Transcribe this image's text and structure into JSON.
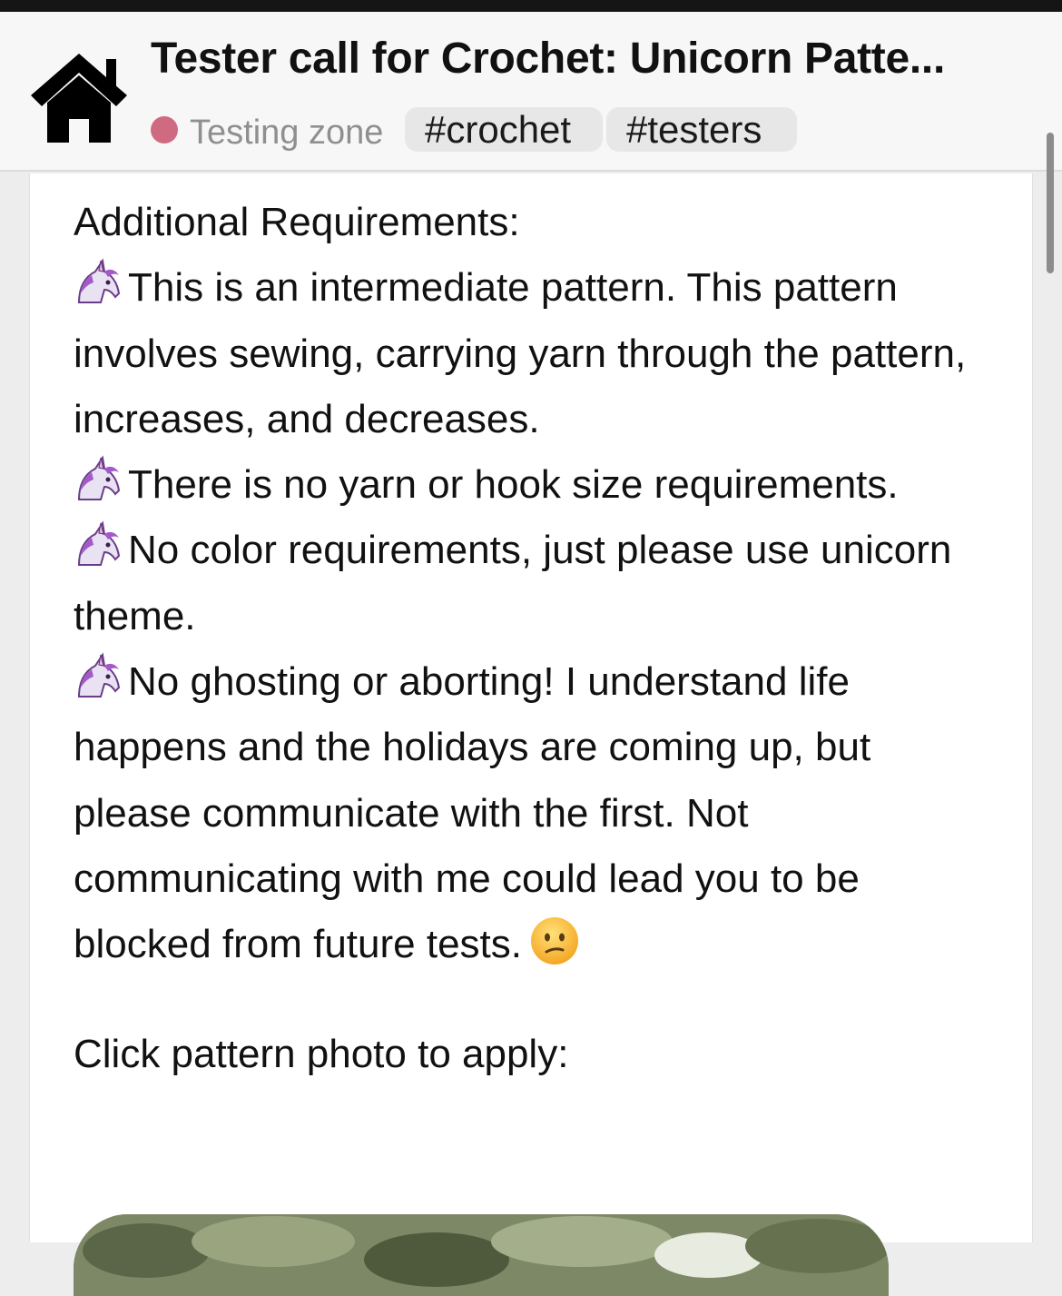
{
  "header": {
    "title": "Tester call for Crochet: Unicorn Patte...",
    "category": "Testing zone",
    "category_color": "#d06a80",
    "tags": [
      "#crochet",
      "#testers"
    ]
  },
  "post": {
    "heading": "Additional Requirements:",
    "bullet_icon": "unicorn-emoji",
    "bullets": [
      "This is an intermediate pattern. This pattern involves sewing, carrying yarn through the pattern, increases, and decreases.",
      "There is no yarn or hook size requirements.",
      "No color requirements, just please use unicorn theme.",
      "No ghosting or aborting! I understand life happens and the holidays are coming up, but please communicate with the first. Not communicating with me could lead you to be blocked from future tests."
    ],
    "trailing_emoji": "confused-face-emoji",
    "cta": "Click pattern photo to apply:"
  }
}
